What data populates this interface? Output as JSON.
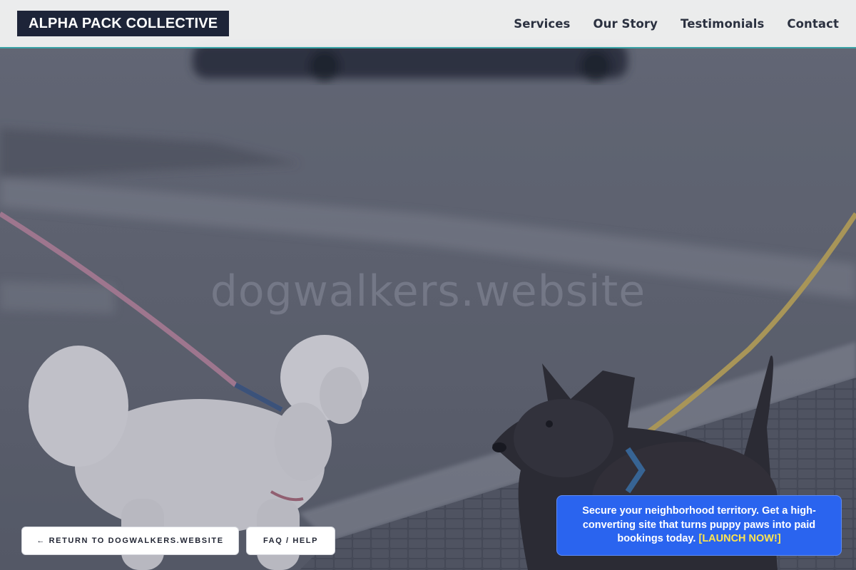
{
  "header": {
    "logo": "ALPHA PACK COLLECTIVE",
    "nav": [
      "Services",
      "Our Story",
      "Testimonials",
      "Contact"
    ]
  },
  "hero": {
    "watermark": "dogwalkers.website"
  },
  "buttons": {
    "return_label": "← RETURN TO DOGWALKERS.WEBSITE",
    "faq_label": "FAQ / HELP"
  },
  "promo": {
    "text": "Secure your neighborhood territory. Get a high-converting site that turns puppy paws into paid bookings today.",
    "cta": "[LAUNCH NOW!]"
  },
  "colors": {
    "header_bg": "#f6f6f6",
    "header_accent": "#3aa3a6",
    "logo_bg": "#1d2438",
    "promo_bg": "#2a64ef",
    "promo_cta": "#ffe44d"
  }
}
